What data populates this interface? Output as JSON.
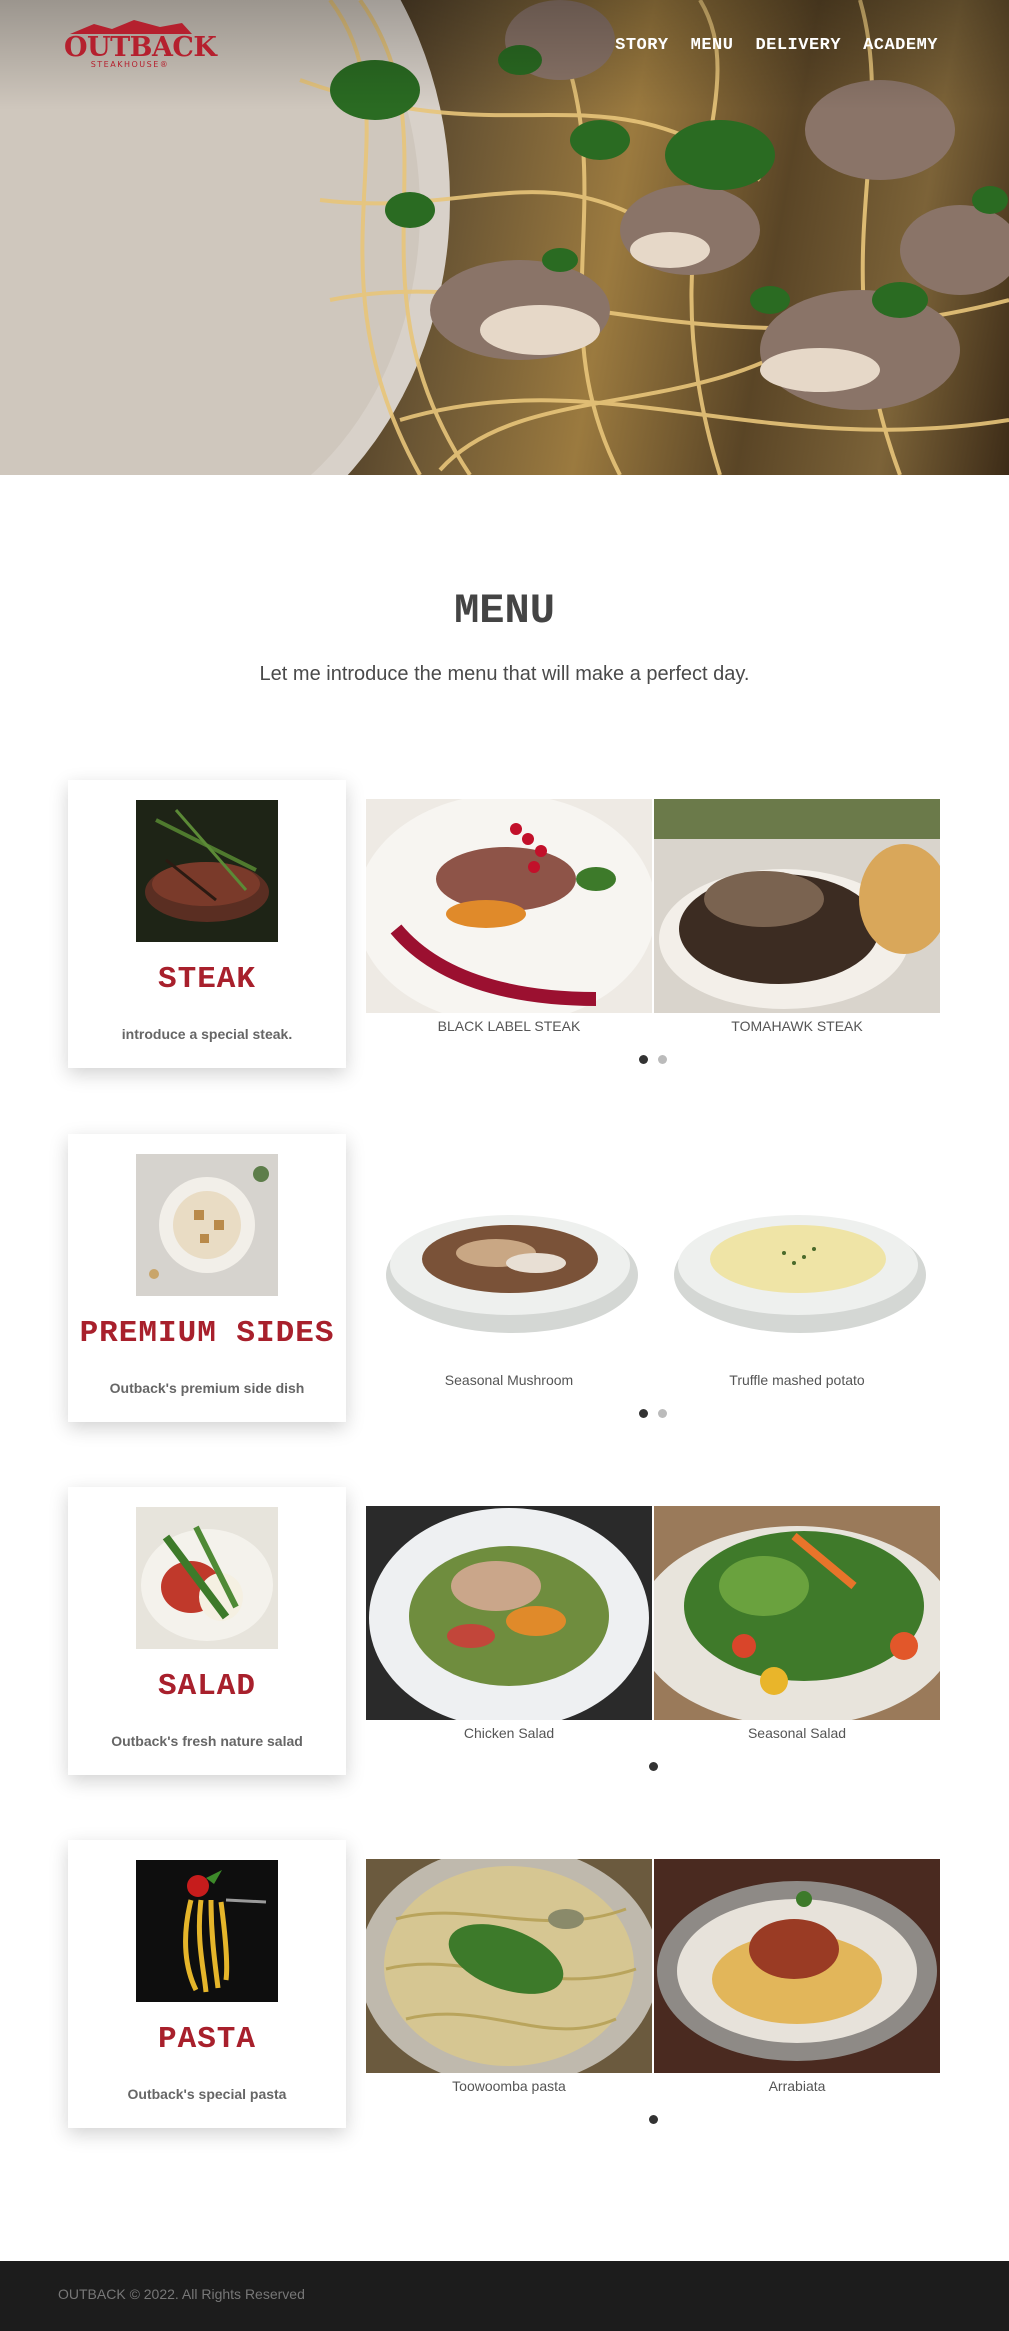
{
  "brand": {
    "logo_name": "OUTBACK",
    "logo_sub": "STEAKHOUSE®",
    "accent": "#b5202e"
  },
  "nav": {
    "items": [
      {
        "label": "STORY"
      },
      {
        "label": "MENU"
      },
      {
        "label": "DELIVERY"
      },
      {
        "label": "ACADEMY"
      }
    ]
  },
  "hero": {
    "image_icon": "pasta-mushroom-hero-image"
  },
  "intro": {
    "title": "MENU",
    "subtitle": "Let me introduce the menu that will make a perfect day."
  },
  "sections": [
    {
      "title": "STEAK",
      "description": "introduce a special steak.",
      "items": [
        {
          "label": "BLACK LABEL STEAK"
        },
        {
          "label": "TOMAHAWK STEAK"
        }
      ],
      "dots": 2,
      "active_dot": 0
    },
    {
      "title": "PREMIUM SIDES",
      "description": "Outback's premium side dish",
      "items": [
        {
          "label": "Seasonal Mushroom"
        },
        {
          "label": "Truffle mashed potato"
        }
      ],
      "dots": 2,
      "active_dot": 0
    },
    {
      "title": "SALAD",
      "description": "Outback's fresh nature salad",
      "items": [
        {
          "label": "Chicken Salad"
        },
        {
          "label": "Seasonal Salad"
        }
      ],
      "dots": 1,
      "active_dot": 0
    },
    {
      "title": "PASTA",
      "description": "Outback's special pasta",
      "items": [
        {
          "label": "Toowoomba pasta"
        },
        {
          "label": "Arrabiata"
        }
      ],
      "dots": 1,
      "active_dot": 0
    }
  ],
  "footer": {
    "copyright": "OUTBACK © 2022. All Rights Reserved"
  }
}
